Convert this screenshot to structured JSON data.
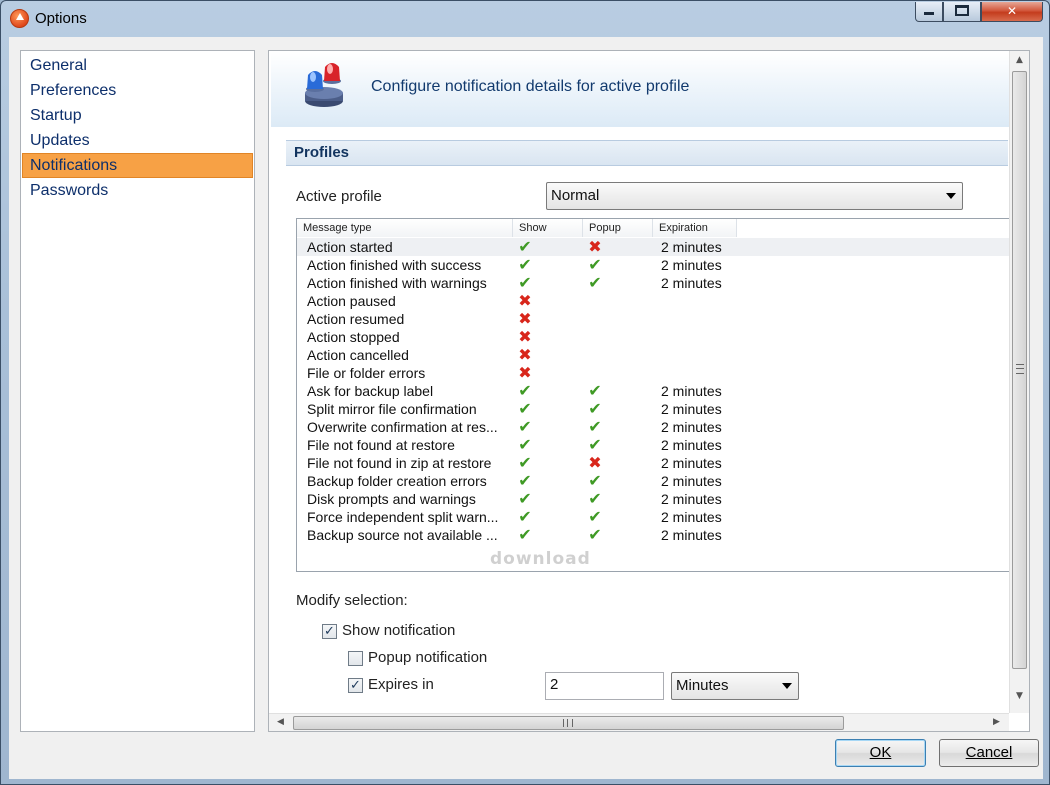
{
  "window": {
    "title": "Options",
    "close_label": "✕"
  },
  "nav": {
    "items": [
      "General",
      "Preferences",
      "Startup",
      "Updates",
      "Notifications",
      "Passwords"
    ],
    "selected": "Notifications"
  },
  "header": {
    "text": "Configure notification details for active profile"
  },
  "section": {
    "title": "Profiles"
  },
  "active_profile": {
    "label": "Active profile",
    "value": "Normal"
  },
  "table": {
    "columns": [
      "Message type",
      "Show",
      "Popup",
      "Expiration"
    ],
    "rows": [
      {
        "type": "Action started",
        "show": "yes",
        "popup": "no",
        "expiration": "2 minutes"
      },
      {
        "type": "Action finished with success",
        "show": "yes",
        "popup": "yes",
        "expiration": "2 minutes"
      },
      {
        "type": "Action finished with warnings",
        "show": "yes",
        "popup": "yes",
        "expiration": "2 minutes"
      },
      {
        "type": "Action paused",
        "show": "no",
        "popup": "",
        "expiration": ""
      },
      {
        "type": "Action resumed",
        "show": "no",
        "popup": "",
        "expiration": ""
      },
      {
        "type": "Action stopped",
        "show": "no",
        "popup": "",
        "expiration": ""
      },
      {
        "type": "Action cancelled",
        "show": "no",
        "popup": "",
        "expiration": ""
      },
      {
        "type": "File or folder errors",
        "show": "no",
        "popup": "",
        "expiration": ""
      },
      {
        "type": "Ask for backup label",
        "show": "yes",
        "popup": "yes",
        "expiration": "2 minutes"
      },
      {
        "type": "Split mirror file confirmation",
        "show": "yes",
        "popup": "yes",
        "expiration": "2 minutes"
      },
      {
        "type": "Overwrite confirmation at res...",
        "show": "yes",
        "popup": "yes",
        "expiration": "2 minutes"
      },
      {
        "type": "File not found at restore",
        "show": "yes",
        "popup": "yes",
        "expiration": "2 minutes"
      },
      {
        "type": "File not found in zip at restore",
        "show": "yes",
        "popup": "no",
        "expiration": "2 minutes"
      },
      {
        "type": "Backup folder creation errors",
        "show": "yes",
        "popup": "yes",
        "expiration": "2 minutes"
      },
      {
        "type": "Disk prompts and warnings",
        "show": "yes",
        "popup": "yes",
        "expiration": "2 minutes"
      },
      {
        "type": "Force independent split warn...",
        "show": "yes",
        "popup": "yes",
        "expiration": "2 minutes"
      },
      {
        "type": "Backup source not available ...",
        "show": "yes",
        "popup": "yes",
        "expiration": "2 minutes"
      }
    ]
  },
  "modify": {
    "label": "Modify selection:",
    "show_notification": {
      "label": "Show notification",
      "checked": true
    },
    "popup_notification": {
      "label": "Popup notification",
      "checked": false
    },
    "expires_in": {
      "label": "Expires in",
      "checked": true,
      "value": "2",
      "unit": "Minutes"
    }
  },
  "watermark": "download",
  "buttons": {
    "ok": "OK",
    "cancel": "Cancel"
  }
}
